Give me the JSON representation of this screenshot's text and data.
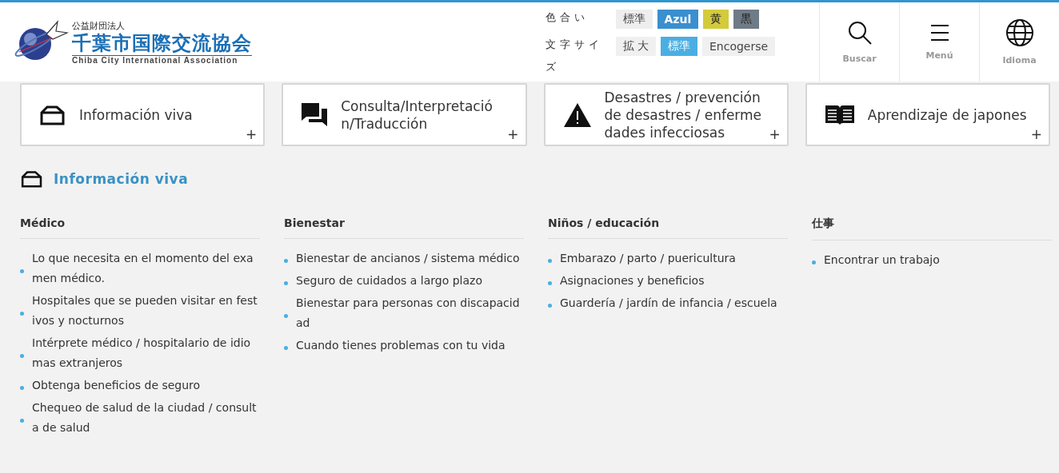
{
  "header": {
    "logo": {
      "small": "公益財団法人",
      "name": "千葉市国際交流協会",
      "english": "Chiba City International Association"
    },
    "tone": {
      "label": "色合い",
      "options": [
        {
          "label": "標準",
          "color": "#eeeeee",
          "selected": false
        },
        {
          "label": "Azul",
          "color": "#3a8fcf",
          "selected": true
        },
        {
          "label": "黄",
          "color": "#d3cb3c",
          "selected": false
        },
        {
          "label": "黒",
          "color": "#6f7b86",
          "selected": false
        }
      ]
    },
    "size": {
      "label": "文字サイズ",
      "options": [
        {
          "label": "拡 大",
          "selected": false
        },
        {
          "label": "標準",
          "selected": true
        },
        {
          "label": "Encogerse",
          "selected": false
        }
      ]
    },
    "nav": [
      {
        "label": "Buscar",
        "kind": "search"
      },
      {
        "label": "Menú",
        "kind": "menu"
      },
      {
        "label": "Idioma",
        "kind": "globe"
      }
    ]
  },
  "cards": [
    {
      "label": "Información viva",
      "kind": "house",
      "toggle": "+"
    },
    {
      "label": "Consulta/Interpretación/Traducción",
      "kind": "chat",
      "toggle": "+"
    },
    {
      "label": "Desastres / prevención de desastres / enfermedades infecciosas",
      "kind": "warning",
      "toggle": "+"
    },
    {
      "label": "Aprendizaje de japones",
      "kind": "book",
      "toggle": "+"
    }
  ],
  "section": {
    "title": "Información viva",
    "kind": "house",
    "columns": [
      {
        "heading": "Médico",
        "items": [
          "Lo que necesita en el momento del examen médico.",
          "Hospitales que se pueden visitar en festivos y nocturnos",
          "Intérprete médico / hospitalario de idiomas extranjeros",
          "Obtenga beneficios de seguro",
          "Chequeo de salud de la ciudad / consulta de salud"
        ]
      },
      {
        "heading": "Bienestar",
        "items": [
          "Bienestar de ancianos / sistema médico",
          "Seguro de cuidados a largo plazo",
          "Bienestar para personas con discapacidad",
          "Cuando tienes problemas con tu vida"
        ]
      },
      {
        "heading": "Niños / educación",
        "items": [
          "Embarazo / parto / puericultura",
          "Asignaciones y beneficios",
          "Guardería / jardín de infancia / escuela"
        ]
      },
      {
        "heading": "仕事",
        "items": [
          "Encontrar un trabajo"
        ]
      }
    ]
  }
}
